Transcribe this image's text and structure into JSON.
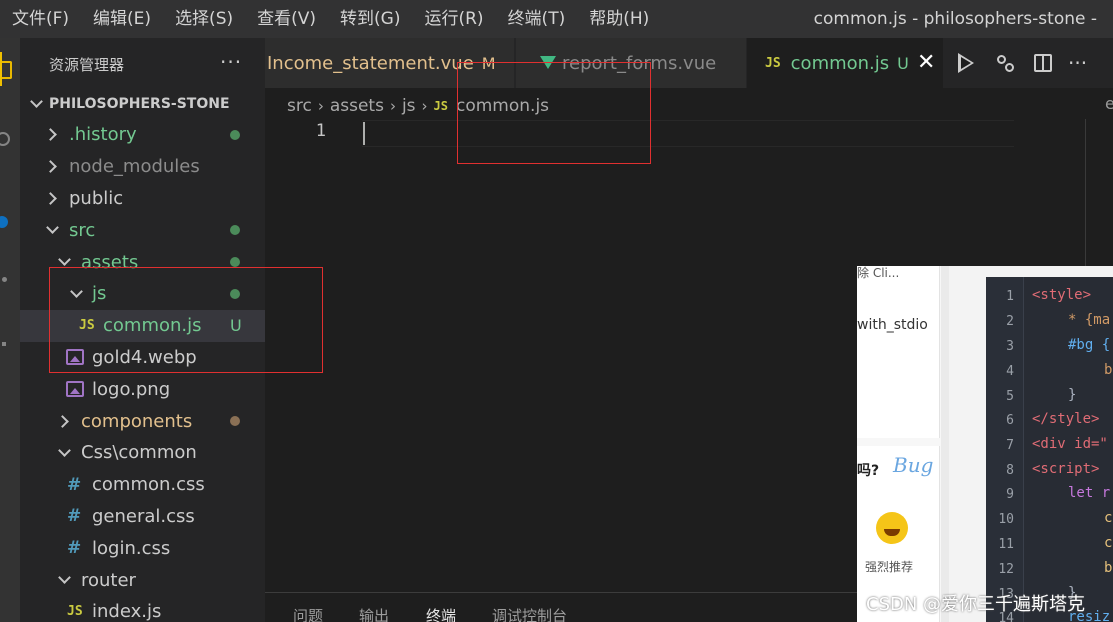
{
  "menu": [
    "文件(F)",
    "编辑(E)",
    "选择(S)",
    "查看(V)",
    "转到(G)",
    "运行(R)",
    "终端(T)",
    "帮助(H)"
  ],
  "window_title": "common.js - philosophers-stone -",
  "sidebar": {
    "title": "资源管理器",
    "more": "···",
    "project": "PHILOSOPHERS-STONE",
    "items": [
      {
        "label": ".history",
        "color": "#73c991"
      },
      {
        "label": "node_modules",
        "color": "#8c8c8c"
      },
      {
        "label": "public",
        "color": "#cccccc"
      },
      {
        "label": "src",
        "color": "#73c991"
      },
      {
        "label": "assets",
        "color": "#73c991"
      },
      {
        "label": "js",
        "color": "#73c991"
      },
      {
        "label": "common.js",
        "badge": "U",
        "color": "#73c991"
      },
      {
        "label": "gold4.webp",
        "color": "#cccccc"
      },
      {
        "label": "logo.png",
        "color": "#cccccc"
      },
      {
        "label": "components",
        "color": "#e2c08d"
      },
      {
        "label": "Css\\common",
        "color": "#cccccc"
      },
      {
        "label": "common.css",
        "color": "#cccccc"
      },
      {
        "label": "general.css",
        "color": "#cccccc"
      },
      {
        "label": "login.css",
        "color": "#cccccc"
      },
      {
        "label": "router",
        "color": "#cccccc"
      },
      {
        "label": "index.js",
        "color": "#cccccc"
      }
    ],
    "js_icon": "JS",
    "css_icon": "#"
  },
  "tabs": [
    {
      "label": "Income_statement.vue",
      "badge": "M"
    },
    {
      "label": "report_forms.vue"
    },
    {
      "label": "common.js",
      "badge": "U",
      "icon": "JS",
      "close": "✕"
    }
  ],
  "breadcrumb": {
    "parts": [
      "src",
      "assets",
      "js"
    ],
    "file": "common.js",
    "icon": "JS",
    "sep": "›"
  },
  "editor": {
    "line_number": "1",
    "right_char": "e"
  },
  "panel": {
    "tabs": [
      "问题",
      "输出",
      "终端",
      "调试控制台"
    ],
    "active": "终端"
  },
  "overlay": {
    "top_text": "除 Cli...",
    "with_stdio": "with_stdio",
    "question": "吗?",
    "bug": "Bug",
    "recommend": "强烈推荐",
    "line_numbers": [
      "1",
      "2",
      "3",
      "4",
      "5",
      "6",
      "7",
      "8",
      "9",
      "10",
      "11",
      "12",
      "13",
      "14"
    ],
    "code_lines": [
      "<style>",
      "* {ma",
      "#bg {",
      "b",
      "}",
      "</style>",
      "<div id=\"",
      "<script>",
      "let r",
      "c",
      "c",
      "b",
      "}",
      "resiz"
    ]
  },
  "watermark": "CSDN @爱你三千遍斯塔克"
}
